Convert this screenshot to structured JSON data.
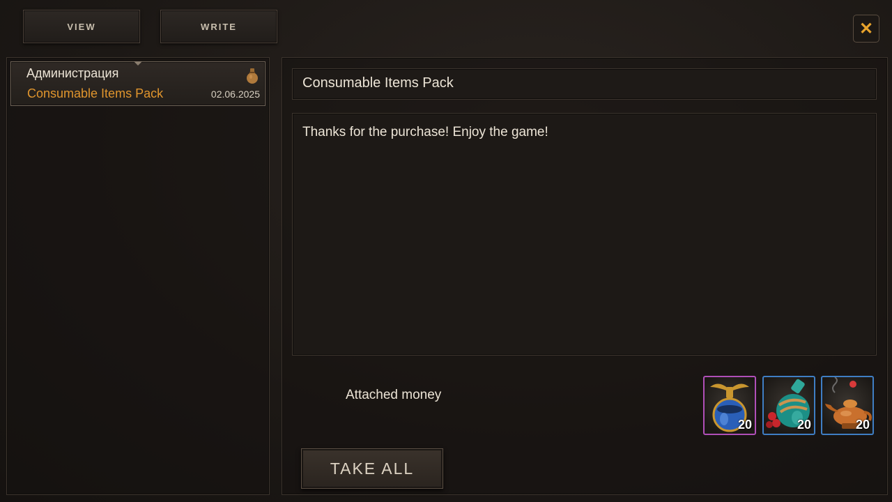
{
  "tabs": {
    "view_label": "VIEW",
    "write_label": "WRITE"
  },
  "close_label": "✕",
  "mail_list": [
    {
      "sender": "Администрация",
      "subject": "Consumable Items Pack",
      "date": "02.06.2025",
      "icon": "money-bag-icon"
    }
  ],
  "message": {
    "subject": "Consumable Items Pack",
    "body": "Thanks for the purchase! Enjoy the game!",
    "attached_money_label": "Attached money",
    "attachments": [
      {
        "icon": "blue-winged-potion-icon",
        "quantity": "20",
        "rarity_color": "#b04fb8"
      },
      {
        "icon": "teal-berry-flask-icon",
        "quantity": "20",
        "rarity_color": "#3f7ec4"
      },
      {
        "icon": "golden-lamp-icon",
        "quantity": "20",
        "rarity_color": "#3f7ec4"
      }
    ],
    "take_all_label": "TAKE ALL"
  },
  "colors": {
    "accent": "#e8a32c",
    "subject_highlight": "#e0952d"
  }
}
